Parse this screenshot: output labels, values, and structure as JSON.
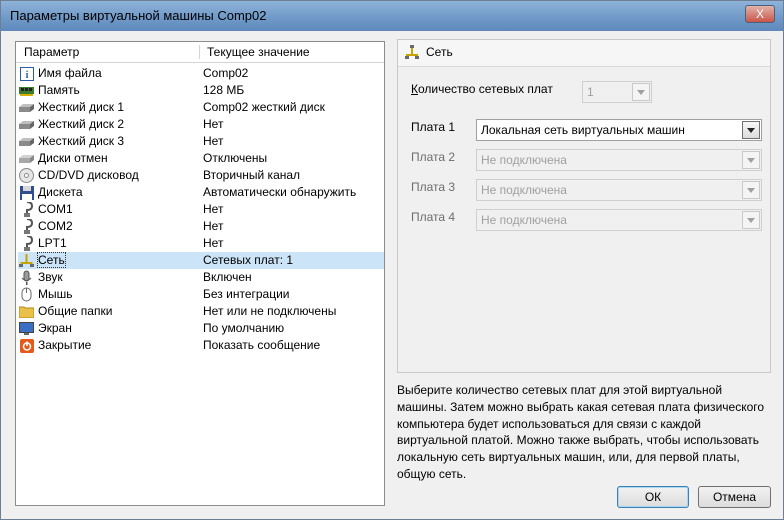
{
  "window": {
    "title": "Параметры виртуальной машины Comp02",
    "close_glyph": "X"
  },
  "columns": {
    "param": "Параметр",
    "value": "Текущее значение"
  },
  "items": [
    {
      "label": "Имя файла",
      "value": "Comp02",
      "icon": "info-icon"
    },
    {
      "label": "Память",
      "value": "128 МБ",
      "icon": "memory-icon"
    },
    {
      "label": "Жесткий диск 1",
      "value": "Comp02 жесткий диск",
      "icon": "hard-disk-icon"
    },
    {
      "label": "Жесткий диск 2",
      "value": "Нет",
      "icon": "hard-disk-icon"
    },
    {
      "label": "Жесткий диск 3",
      "value": "Нет",
      "icon": "hard-disk-icon"
    },
    {
      "label": "Диски отмен",
      "value": "Отключены",
      "icon": "undo-disk-icon"
    },
    {
      "label": "CD/DVD дисковод",
      "value": "Вторичный канал",
      "icon": "cd-icon"
    },
    {
      "label": "Дискета",
      "value": "Автоматически обнаружить",
      "icon": "floppy-icon"
    },
    {
      "label": "COM1",
      "value": "Нет",
      "icon": "port-icon"
    },
    {
      "label": "COM2",
      "value": "Нет",
      "icon": "port-icon"
    },
    {
      "label": "LPT1",
      "value": "Нет",
      "icon": "port-icon"
    },
    {
      "label": "Сеть",
      "value": "Сетевых плат: 1",
      "icon": "network-icon",
      "selected": true
    },
    {
      "label": "Звук",
      "value": "Включен",
      "icon": "sound-icon"
    },
    {
      "label": "Мышь",
      "value": "Без интеграции",
      "icon": "mouse-icon"
    },
    {
      "label": "Общие папки",
      "value": "Нет или не подключены",
      "icon": "folder-icon"
    },
    {
      "label": "Экран",
      "value": "По умолчанию",
      "icon": "display-icon"
    },
    {
      "label": "Закрытие",
      "value": "Показать сообщение",
      "icon": "power-icon"
    }
  ],
  "network": {
    "header": "Сеть",
    "count_label": "Количество сетевых плат",
    "count_value": "1",
    "adapters": [
      {
        "label": "Плата 1",
        "value": "Локальная сеть виртуальных машин",
        "enabled": true
      },
      {
        "label": "Плата 2",
        "value": "Не подключена",
        "enabled": false
      },
      {
        "label": "Плата 3",
        "value": "Не подключена",
        "enabled": false
      },
      {
        "label": "Плата 4",
        "value": "Не подключена",
        "enabled": false
      }
    ]
  },
  "description": "Выберите количество сетевых плат для этой виртуальной машины. Затем можно выбрать какая сетевая плата физического компьютера будет использоваться для связи с каждой виртуальной платой. Можно также выбрать, чтобы использовать локальную сеть виртуальных машин, или, для первой платы, общую сеть.",
  "buttons": {
    "ok": "ОК",
    "cancel": "Отмена"
  },
  "colors": {
    "selection": "#cce4f7",
    "title_bar": "#6e98c7"
  }
}
